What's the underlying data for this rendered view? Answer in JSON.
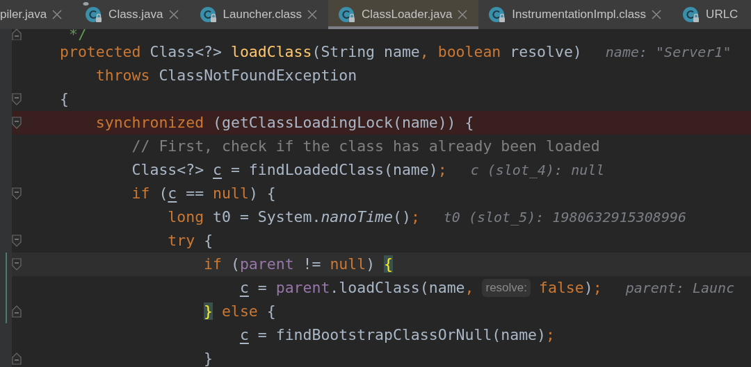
{
  "tabs": [
    {
      "label": "piler.java",
      "closable": true,
      "selected": false
    },
    {
      "label": "Class.java",
      "icon": true,
      "pinned": true,
      "closable": true,
      "selected": false
    },
    {
      "label": "Launcher.class",
      "icon": true,
      "closable": true,
      "selected": false
    },
    {
      "label": "ClassLoader.java",
      "icon": true,
      "closable": true,
      "selected": true
    },
    {
      "label": "InstrumentationImpl.class",
      "icon": true,
      "closable": true,
      "selected": false
    },
    {
      "label": "URLC",
      "icon": true,
      "selected": false
    }
  ],
  "editor": {
    "lines": [
      {
        "fold_end": true,
        "segments": [
          {
            "kind": "code",
            "tokens": [
              {
                "text": " */",
                "kind": "doc"
              }
            ]
          }
        ]
      },
      {
        "segments": [
          {
            "kind": "code",
            "tokens": [
              {
                "text": "protected",
                "kind": "kw"
              },
              {
                "text": " Class<?> ",
                "kind": "plain"
              },
              {
                "text": "loadClass",
                "kind": "method"
              },
              {
                "text": "(String name",
                "kind": "plain"
              },
              {
                "text": ", boolean",
                "kind": "kw"
              },
              {
                "text": " resolve)",
                "kind": "plain"
              }
            ]
          },
          {
            "kind": "hint",
            "text": "name: \"Server1\""
          }
        ]
      },
      {
        "segments": [
          {
            "kind": "code",
            "tokens": [
              {
                "text": "    throws",
                "kind": "kw"
              },
              {
                "text": " ClassNotFoundException",
                "kind": "plain"
              }
            ]
          }
        ]
      },
      {
        "fold_start": true,
        "segments": [
          {
            "kind": "code",
            "tokens": [
              {
                "text": "{",
                "kind": "plain"
              }
            ]
          }
        ]
      },
      {
        "fold_start": true,
        "breakpoint": true,
        "segments": [
          {
            "kind": "code",
            "tokens": [
              {
                "text": "    synchronized",
                "kind": "kw"
              },
              {
                "text": " (getClassLoadingLock(name)) {",
                "kind": "plain"
              }
            ]
          }
        ]
      },
      {
        "segments": [
          {
            "kind": "code",
            "tokens": [
              {
                "text": "        // First, check if the class has already been loaded",
                "kind": "comment"
              }
            ]
          }
        ]
      },
      {
        "segments": [
          {
            "kind": "code",
            "tokens": [
              {
                "text": "        Class<?> ",
                "kind": "plain"
              },
              {
                "text": "c",
                "kind": "var"
              },
              {
                "text": " = findLoadedClass(name)",
                "kind": "plain"
              },
              {
                "text": ";",
                "kind": "kw"
              }
            ]
          },
          {
            "kind": "hint",
            "text": "c (slot_4): null"
          }
        ]
      },
      {
        "fold_start": true,
        "segments": [
          {
            "kind": "code",
            "tokens": [
              {
                "text": "        if",
                "kind": "kw"
              },
              {
                "text": " (",
                "kind": "plain"
              },
              {
                "text": "c",
                "kind": "var"
              },
              {
                "text": " == ",
                "kind": "plain"
              },
              {
                "text": "null",
                "kind": "kw"
              },
              {
                "text": ") {",
                "kind": "plain"
              }
            ]
          }
        ]
      },
      {
        "segments": [
          {
            "kind": "code",
            "tokens": [
              {
                "text": "            long",
                "kind": "kw"
              },
              {
                "text": " t0 = System.",
                "kind": "plain"
              },
              {
                "text": "nanoTime",
                "kind": "static"
              },
              {
                "text": "()",
                "kind": "plain"
              },
              {
                "text": ";",
                "kind": "kw"
              }
            ]
          },
          {
            "kind": "hint",
            "text": "t0 (slot_5): 1980632915308996"
          }
        ]
      },
      {
        "fold_start": true,
        "segments": [
          {
            "kind": "code",
            "tokens": [
              {
                "text": "            try",
                "kind": "kw"
              },
              {
                "text": " {",
                "kind": "plain"
              }
            ]
          }
        ]
      },
      {
        "fold_start": true,
        "current_line": true,
        "changed": true,
        "segments": [
          {
            "kind": "code",
            "tokens": [
              {
                "text": "                if",
                "kind": "kw"
              },
              {
                "text": " (",
                "kind": "plain"
              },
              {
                "text": "parent",
                "kind": "field"
              },
              {
                "text": " != ",
                "kind": "plain"
              },
              {
                "text": "null",
                "kind": "kw"
              },
              {
                "text": ") ",
                "kind": "plain"
              },
              {
                "text": "{",
                "kind": "brace"
              }
            ]
          }
        ]
      },
      {
        "changed": true,
        "segments": [
          {
            "kind": "code",
            "tokens": [
              {
                "text": "                    c",
                "kind": "var"
              },
              {
                "text": " = ",
                "kind": "plain"
              },
              {
                "text": "parent",
                "kind": "field"
              },
              {
                "text": ".loadClass(name",
                "kind": "plain"
              },
              {
                "text": ",",
                "kind": "kw"
              }
            ]
          },
          {
            "kind": "inlay",
            "text": "resolve:"
          },
          {
            "kind": "code",
            "tokens": [
              {
                "text": "false",
                "kind": "kw"
              },
              {
                "text": ")",
                "kind": "plain"
              },
              {
                "text": ";",
                "kind": "kw"
              }
            ]
          },
          {
            "kind": "hint",
            "text": "parent: Launc"
          }
        ]
      },
      {
        "fold_end": true,
        "changed": true,
        "segments": [
          {
            "kind": "code",
            "tokens": [
              {
                "text": "                }",
                "kind": "brace"
              },
              {
                "text": " else",
                "kind": "kw"
              },
              {
                "text": " {",
                "kind": "plain"
              }
            ]
          }
        ]
      },
      {
        "segments": [
          {
            "kind": "code",
            "tokens": [
              {
                "text": "                    c",
                "kind": "var"
              },
              {
                "text": " = findBootstrapClassOrNull(name)",
                "kind": "plain"
              },
              {
                "text": ";",
                "kind": "kw"
              }
            ]
          }
        ]
      },
      {
        "fold_end": true,
        "segments": [
          {
            "kind": "code",
            "tokens": [
              {
                "text": "                }",
                "kind": "plain"
              }
            ]
          }
        ]
      }
    ]
  }
}
